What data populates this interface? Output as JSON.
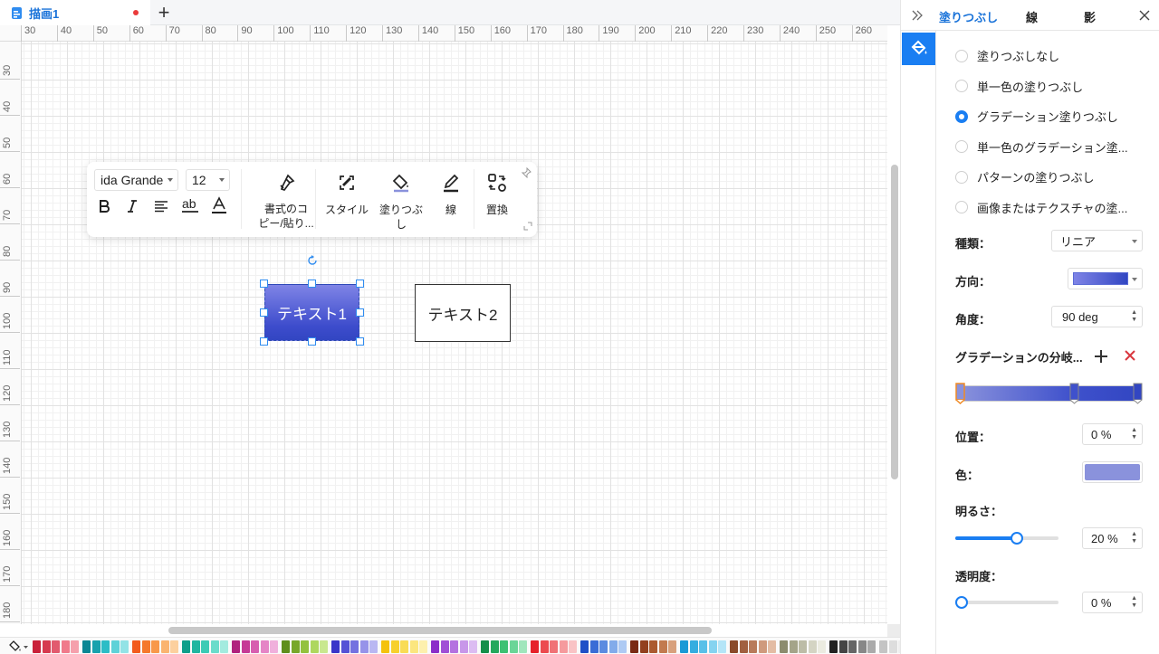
{
  "tab": {
    "title": "描画1",
    "add_label": "+"
  },
  "rulers": {
    "top": [
      "30",
      "40",
      "50",
      "60",
      "70",
      "80",
      "90",
      "100",
      "110",
      "120",
      "130",
      "140",
      "150",
      "160",
      "170",
      "180",
      "190",
      "200",
      "210",
      "220",
      "230",
      "240",
      "250",
      "260"
    ],
    "left": [
      "30",
      "40",
      "50",
      "60",
      "70",
      "80",
      "90",
      "100",
      "110",
      "120",
      "130",
      "140",
      "150",
      "160",
      "170",
      "180"
    ]
  },
  "toolbar": {
    "font_family": "ida Grande",
    "font_size": "12",
    "format_copy_line1": "書式のコ",
    "format_copy_line2": "ピー/貼り...",
    "style_label": "スタイル",
    "fill_label": "塗りつぶし",
    "line_label": "線",
    "replace_label": "置換"
  },
  "shapes": {
    "shape1_text": "テキスト1",
    "shape2_text": "テキスト2"
  },
  "side_tabs": {
    "fill": "塗りつぶし",
    "line": "線",
    "shadow": "影"
  },
  "fill_options": [
    {
      "label": "塗りつぶしなし",
      "checked": false
    },
    {
      "label": "単一色の塗りつぶし",
      "checked": false
    },
    {
      "label": "グラデーション塗りつぶし",
      "checked": true
    },
    {
      "label": "単一色のグラデーション塗...",
      "checked": false
    },
    {
      "label": "パターンの塗りつぶし",
      "checked": false
    },
    {
      "label": "画像またはテクスチャの塗...",
      "checked": false
    }
  ],
  "gradient": {
    "type_label": "種類：",
    "type_value": "リニア",
    "direction_label": "方向：",
    "angle_label": "角度：",
    "angle_value": "90 deg",
    "stops_label": "グラデーションの分岐...",
    "position_label": "位置：",
    "position_value": "0 %",
    "color_label": "色：",
    "color_value": "#8a92dc",
    "brightness_label": "明るさ：",
    "brightness_value": "20 %",
    "brightness_fraction": 0.6,
    "opacity_label": "透明度：",
    "opacity_value": "0 %",
    "opacity_fraction": 0.0
  },
  "colors": {
    "accent": "#1a7ef2",
    "delete_red": "#d9363e",
    "gradient_start": "#7f84e6",
    "gradient_end": "#3246c2"
  },
  "palette": [
    "#c9213a",
    "#d63a4f",
    "#e25a6e",
    "#f07a8b",
    "#f5a0ac",
    "#0b8794",
    "#17a2ad",
    "#2cbdc6",
    "#5fd2d8",
    "#93e3e6",
    "#f25b1d",
    "#f5782b",
    "#f8984a",
    "#fab470",
    "#fcd09e",
    "#0e9f8a",
    "#20b6a0",
    "#3ccbb5",
    "#6bdccb",
    "#a3ebdf",
    "#b0227e",
    "#c63b96",
    "#d75eaf",
    "#e585c6",
    "#f0b0dc",
    "#5f8f1c",
    "#78a82a",
    "#93c23e",
    "#aed75e",
    "#c9e88f",
    "#3a36c9",
    "#5552d6",
    "#7471e0",
    "#9693e9",
    "#b9b7f2",
    "#f4c20d",
    "#f7d02c",
    "#f9dc55",
    "#fbe67f",
    "#fdf0ad",
    "#8b2fc9",
    "#a04fd6",
    "#b472e0",
    "#c897e9",
    "#dcbcf2",
    "#158f4a",
    "#24a85c",
    "#3dc173",
    "#6bd597",
    "#a0e6bc",
    "#e6212a",
    "#ec4a4f",
    "#f07276",
    "#f59a9d",
    "#f9c3c5",
    "#1f4fc7",
    "#3a6cd6",
    "#5b8be0",
    "#82abea",
    "#aecaf3",
    "#7a2a14",
    "#93401f",
    "#ab5a30",
    "#c27a4f",
    "#d8a07c",
    "#1a9ad6",
    "#35ade0",
    "#59c0e8",
    "#85d3f0",
    "#b4e5f7",
    "#8a4a2a",
    "#a16040",
    "#b87b5b",
    "#cf9a7d",
    "#e3bca4",
    "#8c8c6e",
    "#a4a489",
    "#bcbca6",
    "#d4d4c3",
    "#ebebe0",
    "#222222",
    "#444444",
    "#666666",
    "#888888",
    "#aaaaaa",
    "#c4c4c4",
    "#dddddd",
    "#eeeeee"
  ]
}
